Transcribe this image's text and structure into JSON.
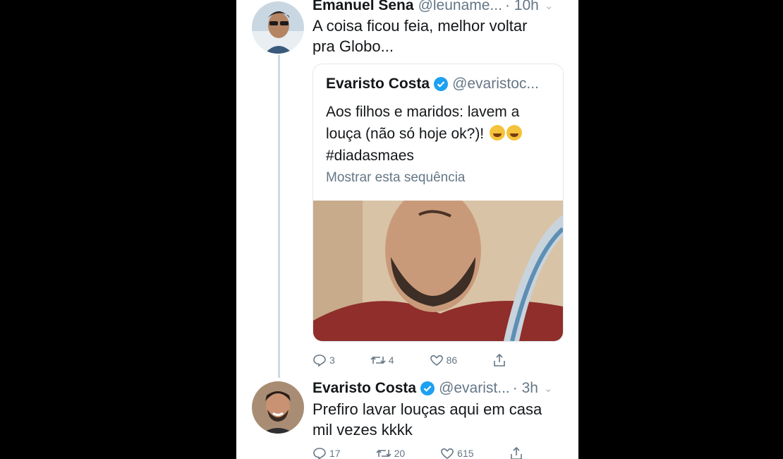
{
  "tweets": [
    {
      "name": "Emanuel Sena",
      "handle": "@leuname...",
      "time": "· 10h",
      "text_line1": "A coisa ficou feia, melhor voltar",
      "text_line2": "pra Globo...",
      "quote": {
        "name": "Evaristo Costa",
        "handle": "@evaristoc...",
        "text_line1": "Aos filhos e maridos: lavem a",
        "text_line2": "louça (não só hoje ok?)!",
        "text_line3": "#diadasmaes",
        "show_thread": "Mostrar esta sequência"
      },
      "replies": "3",
      "retweets": "4",
      "likes": "86"
    },
    {
      "name": "Evaristo Costa",
      "handle": "@evarist...",
      "time": "· 3h",
      "text_line1": "Prefiro lavar louças aqui em casa",
      "text_line2": "mil vezes kkkk",
      "replies": "17",
      "retweets": "20",
      "likes": "615"
    }
  ],
  "colors": {
    "verified": "#1da1f2",
    "muted": "#657786",
    "text": "#14171a"
  },
  "icons": [
    "reply-icon",
    "retweet-icon",
    "like-icon",
    "share-icon",
    "verified-icon",
    "chevron-down-icon"
  ]
}
